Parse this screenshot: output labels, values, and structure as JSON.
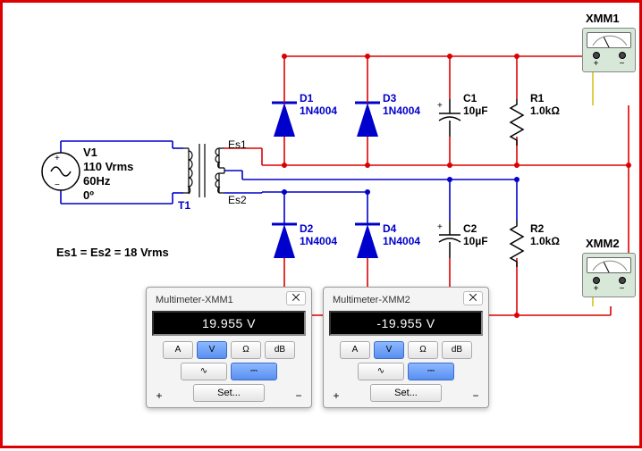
{
  "instruments": {
    "xmm1": {
      "name": "XMM1"
    },
    "xmm2": {
      "name": "XMM2"
    }
  },
  "source": {
    "ref": "V1",
    "voltage": "110 Vrms",
    "freq": "60Hz",
    "phase": "0º"
  },
  "transformer": {
    "ref": "T1",
    "sec1": "Es1",
    "sec2": "Es2",
    "note": "Es1 = Es2 = 18 Vrms"
  },
  "diodes": {
    "d1": {
      "ref": "D1",
      "type": "1N4004"
    },
    "d2": {
      "ref": "D2",
      "type": "1N4004"
    },
    "d3": {
      "ref": "D3",
      "type": "1N4004"
    },
    "d4": {
      "ref": "D4",
      "type": "1N4004"
    }
  },
  "capacitors": {
    "c1": {
      "ref": "C1",
      "value": "10µF"
    },
    "c2": {
      "ref": "C2",
      "value": "10µF"
    }
  },
  "resistors": {
    "r1": {
      "ref": "R1",
      "value": "1.0kΩ"
    },
    "r2": {
      "ref": "R2",
      "value": "1.0kΩ"
    }
  },
  "popup1": {
    "title": "Multimeter-XMM1",
    "reading": "19.955 V",
    "btn_a": "A",
    "btn_v": "V",
    "btn_ohm": "Ω",
    "btn_db": "dB",
    "btn_ac": "∿",
    "btn_dc": "⎓",
    "set": "Set...",
    "close": "⨉"
  },
  "popup2": {
    "title": "Multimeter-XMM2",
    "reading": "-19.955 V",
    "btn_a": "A",
    "btn_v": "V",
    "btn_ohm": "Ω",
    "btn_db": "dB",
    "btn_ac": "∿",
    "btn_dc": "⎓",
    "set": "Set...",
    "close": "⨉"
  },
  "polarity": {
    "plus": "+",
    "minus": "−"
  }
}
